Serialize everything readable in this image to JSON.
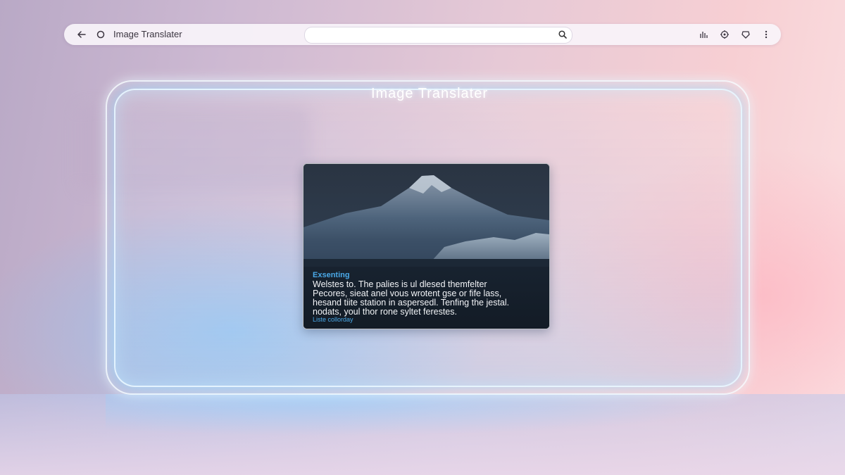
{
  "browser": {
    "title": "Image Translater",
    "url_value": "",
    "url_placeholder": "",
    "icons": [
      "back-arrow-icon",
      "reload-icon",
      "search-icon",
      "chart-icon",
      "extension-icon",
      "profile-icon",
      "more-menu-icon"
    ]
  },
  "panel": {
    "title": "Image Translater"
  },
  "image_card": {
    "heading": "Exsenting",
    "body_lines": [
      "Welstes to. The palies is ul dlesed themfelter",
      "Pecores, sieat anel vous wrotent gse or fife lass,",
      "hesand tiite station in aspersedl. Tenfing the jestal.",
      "nodats, youl thor rone syltet ferestes."
    ],
    "link": "Liste collorday"
  },
  "colors": {
    "accent_blue": "#4aa9e8",
    "panel_glow": "#aee1ff",
    "bg_pink": "#f7cfd3",
    "bg_lilac": "#b9a9c6"
  }
}
